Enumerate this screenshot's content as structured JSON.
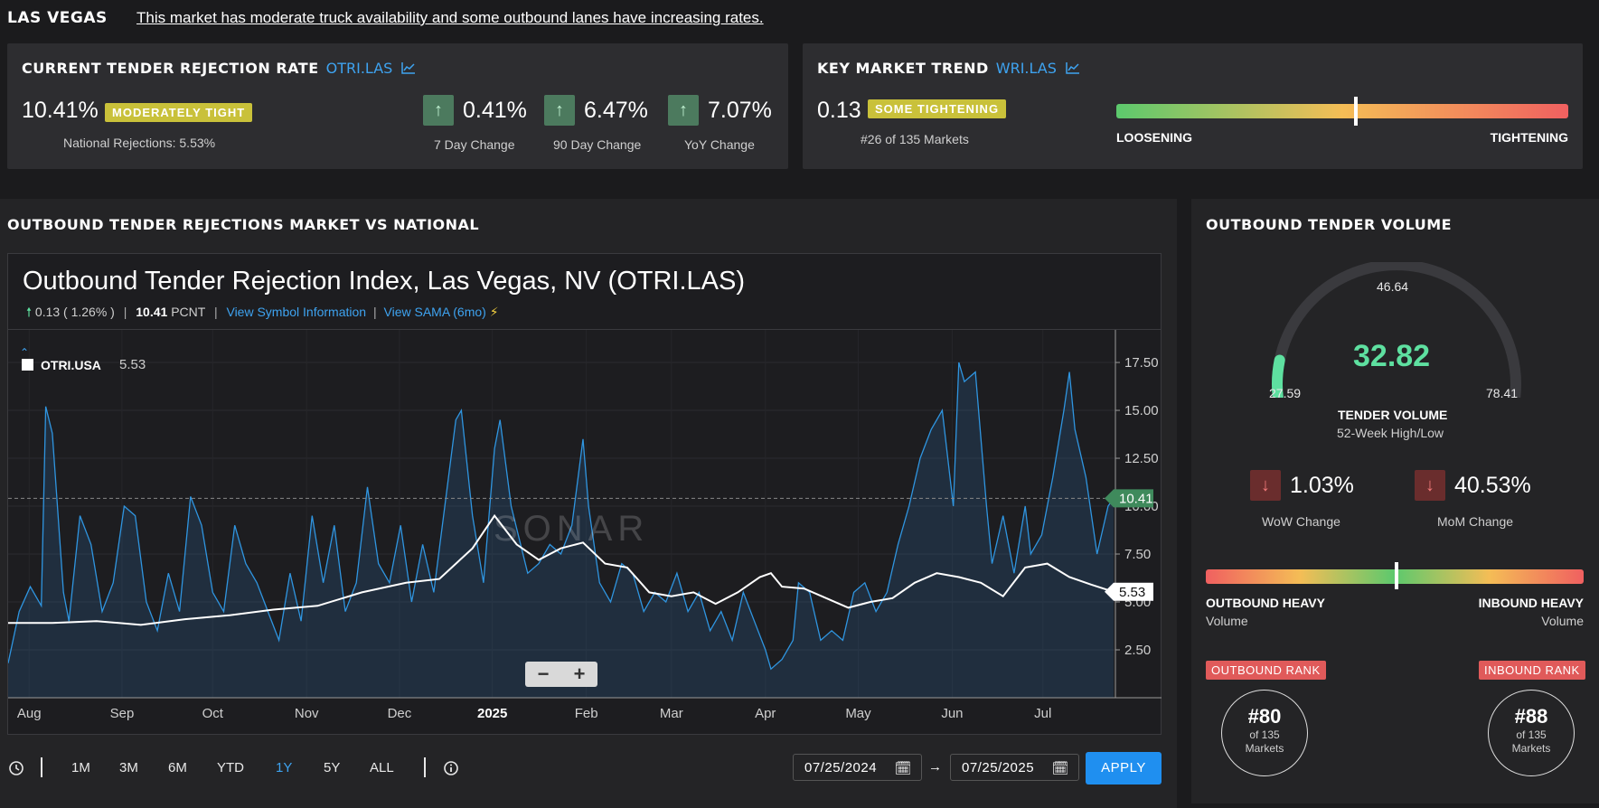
{
  "header": {
    "city": "LAS VEGAS",
    "summary": "This market has moderate truck availability and some outbound lanes have increasing rates."
  },
  "rejection_card": {
    "title": "CURRENT TENDER REJECTION RATE",
    "symbol": "OTRI.LAS",
    "value": "10.41%",
    "badge": "MODERATELY TIGHT",
    "national": "National Rejections: 5.53%",
    "changes": [
      {
        "value": "0.41%",
        "label": "7 Day Change",
        "direction": "up"
      },
      {
        "value": "6.47%",
        "label": "90 Day Change",
        "direction": "up"
      },
      {
        "value": "7.07%",
        "label": "YoY Change",
        "direction": "up"
      }
    ]
  },
  "trend_card": {
    "title": "KEY MARKET TREND",
    "symbol": "WRI.LAS",
    "value": "0.13",
    "badge": "SOME TIGHTENING",
    "rank": "#26 of 135 Markets",
    "left_label": "LOOSENING",
    "right_label": "TIGHTENING",
    "level": 0.53
  },
  "chart_panel": {
    "title": "OUTBOUND TENDER REJECTIONS MARKET VS NATIONAL",
    "chart_title": "Outbound Tender Rejection Index, Las Vegas, NV (OTRI.LAS)",
    "change": "0.13 ( 1.26% )",
    "value_bold": "10.41",
    "unit": "PCNT",
    "view_symbol": "View Symbol Information",
    "view_sama": "View SAMA (6mo)",
    "legend_symbol": "OTRI.USA",
    "legend_value": "5.53",
    "watermark": "SONAR",
    "last_market": "10.41",
    "last_national": "5.53"
  },
  "chart_data": {
    "type": "line",
    "y_ticks": [
      "2.50",
      "5.00",
      "7.50",
      "10.00",
      "12.50",
      "15.00",
      "17.50"
    ],
    "ylim": [
      0,
      19.2
    ],
    "x_ticks": [
      "Aug",
      "Sep",
      "Oct",
      "Nov",
      "Dec",
      "2025",
      "Feb",
      "Mar",
      "Apr",
      "May",
      "Jun",
      "Jul"
    ],
    "x_tick_positions": [
      0.019,
      0.103,
      0.185,
      0.27,
      0.354,
      0.438,
      0.523,
      0.6,
      0.685,
      0.769,
      0.854,
      0.936
    ],
    "series": [
      {
        "name": "OTRI.LAS",
        "color": "#2f95e0",
        "points": [
          [
            0,
            1.8
          ],
          [
            0.01,
            4.5
          ],
          [
            0.02,
            5.8
          ],
          [
            0.03,
            4.8
          ],
          [
            0.034,
            15.2
          ],
          [
            0.04,
            13.8
          ],
          [
            0.05,
            5.5
          ],
          [
            0.055,
            4.0
          ],
          [
            0.065,
            9.5
          ],
          [
            0.075,
            8.0
          ],
          [
            0.085,
            4.5
          ],
          [
            0.095,
            6.0
          ],
          [
            0.105,
            10.0
          ],
          [
            0.115,
            9.5
          ],
          [
            0.125,
            5.0
          ],
          [
            0.135,
            3.5
          ],
          [
            0.145,
            6.5
          ],
          [
            0.155,
            4.5
          ],
          [
            0.165,
            10.5
          ],
          [
            0.175,
            9.0
          ],
          [
            0.185,
            5.5
          ],
          [
            0.195,
            4.5
          ],
          [
            0.205,
            9.0
          ],
          [
            0.215,
            7.0
          ],
          [
            0.225,
            6.0
          ],
          [
            0.235,
            4.5
          ],
          [
            0.245,
            3.0
          ],
          [
            0.255,
            6.5
          ],
          [
            0.265,
            4.0
          ],
          [
            0.275,
            9.5
          ],
          [
            0.285,
            6.0
          ],
          [
            0.295,
            9.0
          ],
          [
            0.305,
            4.5
          ],
          [
            0.315,
            6.0
          ],
          [
            0.325,
            11.0
          ],
          [
            0.335,
            7.0
          ],
          [
            0.345,
            6.0
          ],
          [
            0.355,
            9.0
          ],
          [
            0.365,
            5.0
          ],
          [
            0.375,
            8.0
          ],
          [
            0.385,
            5.5
          ],
          [
            0.395,
            10.0
          ],
          [
            0.405,
            14.5
          ],
          [
            0.41,
            15.0
          ],
          [
            0.42,
            9.5
          ],
          [
            0.43,
            6.0
          ],
          [
            0.44,
            13.0
          ],
          [
            0.445,
            14.5
          ],
          [
            0.455,
            10.0
          ],
          [
            0.47,
            6.5
          ],
          [
            0.48,
            7.0
          ],
          [
            0.49,
            8.0
          ],
          [
            0.5,
            7.5
          ],
          [
            0.51,
            9.0
          ],
          [
            0.52,
            13.5
          ],
          [
            0.525,
            10.0
          ],
          [
            0.535,
            6.0
          ],
          [
            0.545,
            5.0
          ],
          [
            0.555,
            7.0
          ],
          [
            0.565,
            6.5
          ],
          [
            0.575,
            4.5
          ],
          [
            0.585,
            5.5
          ],
          [
            0.595,
            5.0
          ],
          [
            0.605,
            6.5
          ],
          [
            0.615,
            4.5
          ],
          [
            0.625,
            5.5
          ],
          [
            0.635,
            3.5
          ],
          [
            0.645,
            4.5
          ],
          [
            0.655,
            3.0
          ],
          [
            0.665,
            5.5
          ],
          [
            0.675,
            4.0
          ],
          [
            0.685,
            2.5
          ],
          [
            0.69,
            1.5
          ],
          [
            0.7,
            2.0
          ],
          [
            0.71,
            3.0
          ],
          [
            0.715,
            6.0
          ],
          [
            0.725,
            5.5
          ],
          [
            0.735,
            3.0
          ],
          [
            0.745,
            3.5
          ],
          [
            0.755,
            3.0
          ],
          [
            0.765,
            5.5
          ],
          [
            0.775,
            6.0
          ],
          [
            0.785,
            4.5
          ],
          [
            0.795,
            5.5
          ],
          [
            0.805,
            8.0
          ],
          [
            0.815,
            10.0
          ],
          [
            0.825,
            12.5
          ],
          [
            0.835,
            14.0
          ],
          [
            0.845,
            15.0
          ],
          [
            0.855,
            10.0
          ],
          [
            0.86,
            17.5
          ],
          [
            0.865,
            16.5
          ],
          [
            0.875,
            17.0
          ],
          [
            0.885,
            10.0
          ],
          [
            0.89,
            7.0
          ],
          [
            0.9,
            9.5
          ],
          [
            0.91,
            6.5
          ],
          [
            0.92,
            10.0
          ],
          [
            0.925,
            7.5
          ],
          [
            0.935,
            8.5
          ],
          [
            0.945,
            11.5
          ],
          [
            0.955,
            15.0
          ],
          [
            0.96,
            17.0
          ],
          [
            0.965,
            14.0
          ],
          [
            0.975,
            11.5
          ],
          [
            0.985,
            7.5
          ],
          [
            0.995,
            10.0
          ],
          [
            1.0,
            10.41
          ]
        ]
      },
      {
        "name": "OTRI.USA",
        "color": "#ffffff",
        "points": [
          [
            0,
            3.9
          ],
          [
            0.04,
            3.9
          ],
          [
            0.08,
            4.0
          ],
          [
            0.12,
            3.8
          ],
          [
            0.16,
            4.1
          ],
          [
            0.2,
            4.3
          ],
          [
            0.24,
            4.6
          ],
          [
            0.28,
            4.8
          ],
          [
            0.32,
            5.5
          ],
          [
            0.36,
            6.0
          ],
          [
            0.39,
            6.2
          ],
          [
            0.42,
            7.8
          ],
          [
            0.44,
            9.5
          ],
          [
            0.46,
            8.0
          ],
          [
            0.48,
            7.2
          ],
          [
            0.5,
            7.8
          ],
          [
            0.52,
            8.1
          ],
          [
            0.54,
            7.0
          ],
          [
            0.56,
            6.8
          ],
          [
            0.58,
            5.5
          ],
          [
            0.6,
            5.3
          ],
          [
            0.62,
            5.5
          ],
          [
            0.64,
            4.9
          ],
          [
            0.66,
            5.5
          ],
          [
            0.68,
            6.3
          ],
          [
            0.69,
            6.5
          ],
          [
            0.7,
            5.8
          ],
          [
            0.72,
            5.7
          ],
          [
            0.74,
            5.2
          ],
          [
            0.76,
            4.7
          ],
          [
            0.78,
            5.0
          ],
          [
            0.8,
            5.2
          ],
          [
            0.82,
            6.0
          ],
          [
            0.84,
            6.5
          ],
          [
            0.86,
            6.3
          ],
          [
            0.88,
            6.0
          ],
          [
            0.9,
            5.3
          ],
          [
            0.92,
            6.8
          ],
          [
            0.94,
            7.0
          ],
          [
            0.96,
            6.3
          ],
          [
            0.98,
            5.9
          ],
          [
            1.0,
            5.53
          ]
        ]
      }
    ]
  },
  "range_bar": {
    "buttons": [
      "1M",
      "3M",
      "6M",
      "YTD",
      "1Y",
      "5Y",
      "ALL"
    ],
    "active": "1Y",
    "start_date": "07/25/2024",
    "end_date": "07/25/2025",
    "arrow": "→",
    "apply": "APPLY"
  },
  "volume_panel": {
    "title": "OUTBOUND TENDER VOLUME",
    "value": "32.82",
    "low": "27.59",
    "mid": "46.64",
    "high": "78.41",
    "label": "TENDER VOLUME",
    "sublabel": "52-Week High/Low",
    "gauge_fraction": 0.104,
    "changes": [
      {
        "value": "1.03%",
        "label": "WoW Change",
        "direction": "down"
      },
      {
        "value": "40.53%",
        "label": "MoM Change",
        "direction": "down"
      }
    ],
    "balance_left": "OUTBOUND HEAVY",
    "balance_left_sub": "Volume",
    "balance_right": "INBOUND HEAVY",
    "balance_right_sub": "Volume",
    "balance_level": 0.505,
    "outbound_rank_label": "OUTBOUND RANK",
    "outbound_rank": "#80",
    "inbound_rank_label": "INBOUND RANK",
    "inbound_rank": "#88",
    "rank_of_line1": "of 135",
    "rank_of_line2": "Markets"
  },
  "icons": {
    "chart_link": "line-chart-icon",
    "up": "arrow-up-icon",
    "down": "arrow-down-icon",
    "clock": "clock-icon",
    "info": "info-icon",
    "calendar": "calendar-icon"
  },
  "colors": {
    "accent": "#3ea3f0",
    "badge_yellow": "#c9c13a",
    "gauge_green": "#5ee0a0",
    "rank_red": "#e05a5a",
    "up_box": "#4c7a5e",
    "down_box": "#6a2d2d"
  }
}
